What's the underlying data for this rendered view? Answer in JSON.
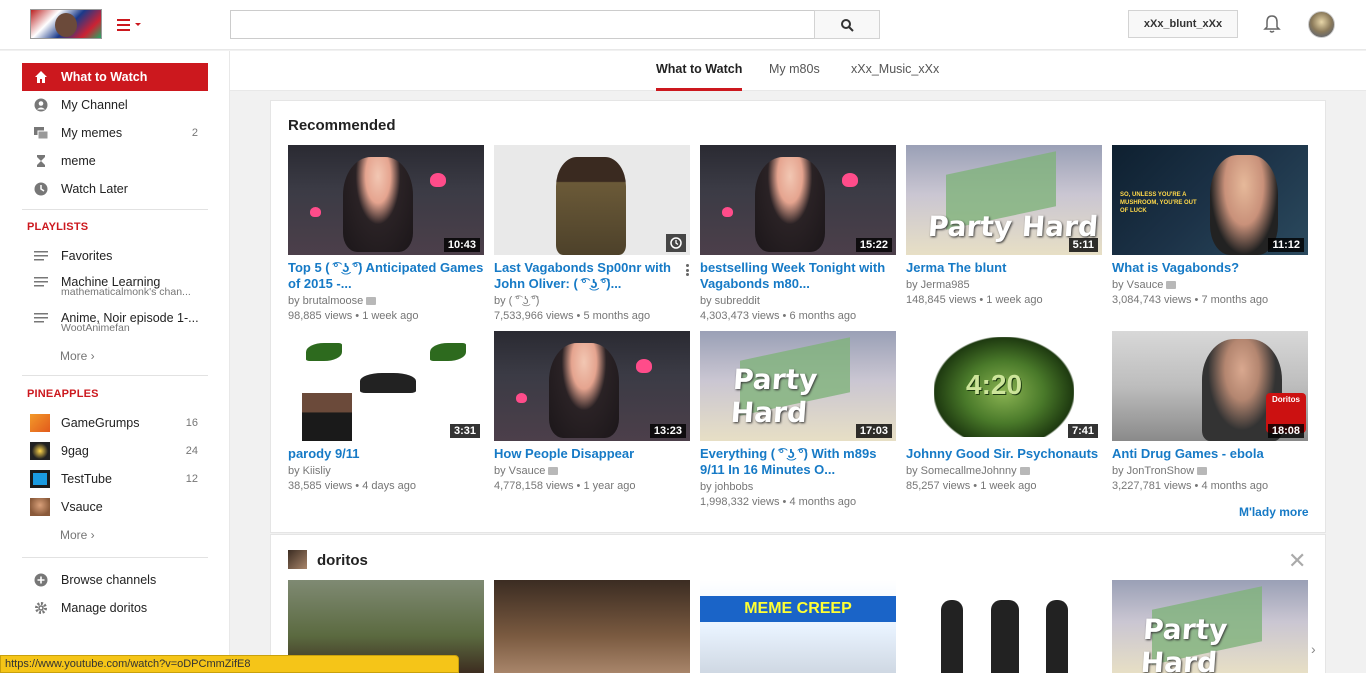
{
  "masthead": {
    "search_placeholder": "",
    "user_button": "xXx_blunt_xXx"
  },
  "sidebar": {
    "main": [
      {
        "label": "What to Watch",
        "icon": "home-icon",
        "active": true
      },
      {
        "label": "My Channel",
        "icon": "person-icon"
      },
      {
        "label": "My memes",
        "icon": "subscriptions-icon",
        "count": "2"
      },
      {
        "label": "meme",
        "icon": "hourglass-icon"
      },
      {
        "label": "Watch Later",
        "icon": "clock-icon"
      }
    ],
    "playlists_heading": "PLAYLISTS",
    "playlists": [
      {
        "label": "Favorites",
        "sub": ""
      },
      {
        "label": "Machine Learning",
        "sub": "mathematicalmonk's chan..."
      },
      {
        "label": "Anime, Noir episode 1-...",
        "sub": "WootAnimefan"
      }
    ],
    "more_label": "More ›",
    "pineapples_heading": "PINEAPPLES",
    "channels": [
      {
        "label": "GameGrumps",
        "count": "16"
      },
      {
        "label": "9gag",
        "count": "24"
      },
      {
        "label": "TestTube",
        "count": "12"
      },
      {
        "label": "Vsauce",
        "count": ""
      }
    ],
    "more2_label": "More ›",
    "footer": [
      {
        "label": "Browse channels",
        "icon": "plus-circle-icon"
      },
      {
        "label": "Manage doritos",
        "icon": "gear-icon"
      }
    ]
  },
  "tabs": [
    {
      "label": "What to Watch",
      "active": true
    },
    {
      "label": "My m80s"
    },
    {
      "label": "xXx_Music_xXx"
    }
  ],
  "recommended": {
    "title": "Recommended",
    "more_link": "M'lady more",
    "row1": [
      {
        "title": "Top 5 ( ͡° ͜ʖ ͡°) Anticipated Games of 2015 -...",
        "by": "by brutalmoose",
        "verified": true,
        "views": "98,885 views",
        "age": "1 week ago",
        "duration": "10:43",
        "thumb": "anime"
      },
      {
        "title": "Last Vagabonds Sp00nr with John Oliver: ( ͡° ͜ʖ ͡°)...",
        "by": "by ( ͡° ͜ʖ ͡°)",
        "verified": false,
        "views": "7,533,966 views",
        "age": "5 months ago",
        "duration": "",
        "thumb": "guy"
      },
      {
        "title": "bestselling Week Tonight with Vagabonds m80...",
        "by": "by subreddit",
        "verified": false,
        "views": "4,303,473 views",
        "age": "6 months ago",
        "duration": "15:22",
        "thumb": "anime"
      },
      {
        "title": "Jerma The blunt",
        "by": "by Jerma985",
        "verified": false,
        "views": "148,845 views",
        "age": "1 week ago",
        "duration": "5:11",
        "thumb": "party"
      },
      {
        "title": "What is Vagabonds?",
        "by": "by Vsauce",
        "verified": true,
        "views": "3,084,743 views",
        "age": "7 months ago",
        "duration": "11:12",
        "thumb": "musk"
      }
    ],
    "row2": [
      {
        "title": "parody 9/11",
        "by": "by Kiisliy",
        "verified": false,
        "views": "38,585 views",
        "age": "4 days ago",
        "duration": "3:31",
        "thumb": "weed"
      },
      {
        "title": "How People Disappear",
        "by": "by Vsauce",
        "verified": true,
        "views": "4,778,158 views",
        "age": "1 year ago",
        "duration": "13:23",
        "thumb": "anime"
      },
      {
        "title": "Everything ( ͡° ͜ʖ ͡°) With m89s 9/11 In 16 Minutes O...",
        "by": "by johbobs",
        "verified": false,
        "views": "1,998,332 views",
        "age": "4 months ago",
        "duration": "17:03",
        "thumb": "party"
      },
      {
        "title": "Johnny Good Sir. Psychonauts",
        "by": "by SomecallmeJohnny",
        "verified": true,
        "views": "85,257 views",
        "age": "1 week ago",
        "duration": "7:41",
        "thumb": "420"
      },
      {
        "title": "Anti Drug Games - ebola",
        "by": "by JonTronShow",
        "verified": true,
        "views": "3,227,781 views",
        "age": "4 months ago",
        "duration": "18:08",
        "thumb": "drug"
      }
    ]
  },
  "thumb_text": {
    "party_hard": "Party Hard",
    "musk_caption": "SO, UNLESS YOU'RE A MUSHROOM, YOU'RE OUT OF LUCK",
    "num_420": "4:20",
    "doritos_bag": "Doritos",
    "meme_creep": "MEME CREEP"
  },
  "doritos_shelf": {
    "title": "doritos"
  },
  "status_bar": {
    "url": "https://www.youtube.com/watch?v=oDPCmmZifE8"
  }
}
